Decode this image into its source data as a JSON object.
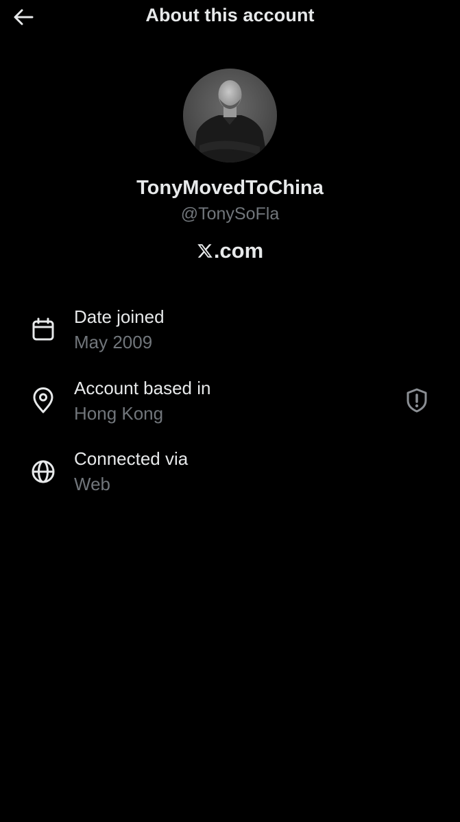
{
  "header": {
    "title": "About this account",
    "back_icon": "arrow-left-icon"
  },
  "profile": {
    "display_name": "TonyMovedToChina",
    "handle": "@TonySoFla",
    "brand_suffix": ".com",
    "brand_logo": "x-logo-icon"
  },
  "info": [
    {
      "icon": "calendar-icon",
      "label": "Date joined",
      "value": "May 2009"
    },
    {
      "icon": "location-pin-icon",
      "label": "Account based in",
      "value": "Hong Kong",
      "badge_icon": "shield-alert-icon"
    },
    {
      "icon": "globe-icon",
      "label": "Connected via",
      "value": "Web"
    }
  ],
  "colors": {
    "background": "#000000",
    "primary_text": "#e7e9ea",
    "secondary_text": "#71767b"
  }
}
